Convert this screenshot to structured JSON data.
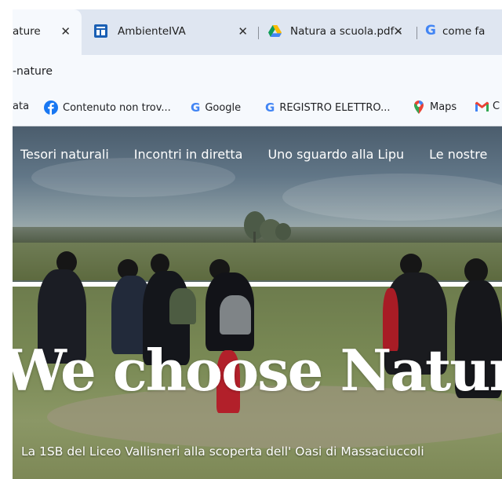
{
  "browser": {
    "tabs": [
      {
        "label": "ature",
        "active": true
      },
      {
        "label": "AmbienteIVA",
        "icon": "ambienteiva-icon"
      },
      {
        "label": "Natura a scuola.pdf -",
        "icon": "google-drive-icon"
      },
      {
        "label": "come fa",
        "icon": "google-icon"
      }
    ],
    "close_glyph": "✕",
    "address": "-nature",
    "bookmarks": [
      {
        "label": "ata",
        "icon": ""
      },
      {
        "label": "Contenuto non trov...",
        "icon": "facebook-icon"
      },
      {
        "label": "Google",
        "icon": "google-icon"
      },
      {
        "label": "REGISTRO ELETTRO...",
        "icon": "google-icon"
      },
      {
        "label": "Maps",
        "icon": "maps-pin-icon"
      },
      {
        "label": "C",
        "icon": "gmail-icon"
      }
    ]
  },
  "site": {
    "nav": [
      "Tesori naturali",
      "Incontri in diretta",
      "Uno sguardo alla Lipu",
      "Le nostre"
    ],
    "hero_title": "We choose Nature",
    "hero_subtitle": "La 1SB del Liceo Vallisneri alla scoperta dell' Oasi di Massaciuccoli"
  },
  "colors": {
    "tabbar": "#dfe6f1",
    "toolbar": "#f6f9fd",
    "google_blue": "#4285f4",
    "google_red": "#ea4335",
    "facebook_blue": "#1877f2"
  }
}
